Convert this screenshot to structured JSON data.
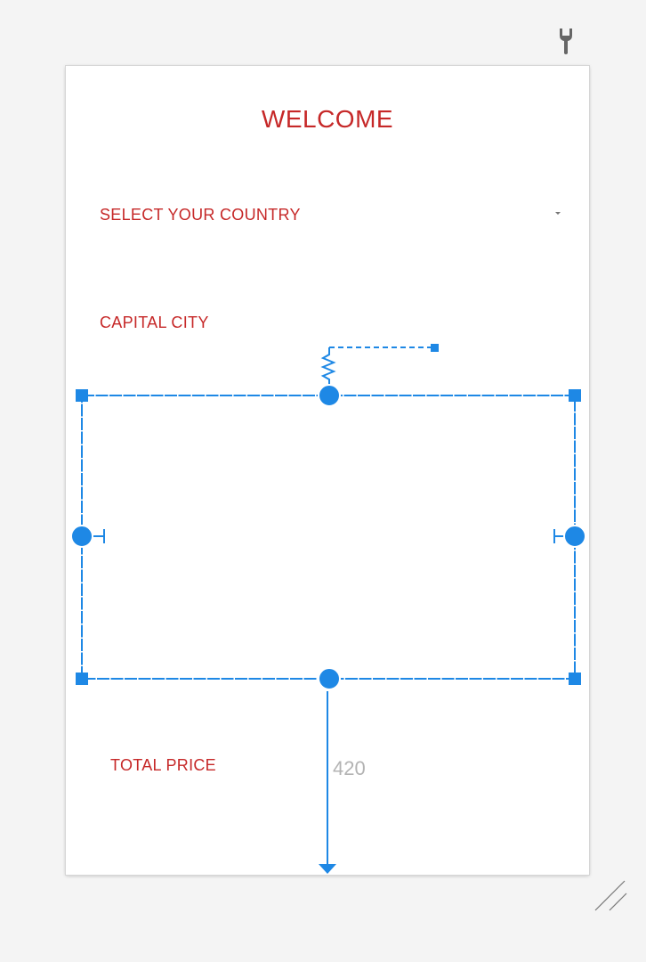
{
  "toolbar": {
    "settings_icon": "wrench-icon"
  },
  "screen": {
    "title": "WELCOME",
    "country_spinner": {
      "selected": "SELECT YOUR COUNTRY",
      "arrow_icon": "dropdown-arrow-icon"
    },
    "capital_label": "CAPITAL CITY",
    "total_price_label": "TOTAL PRICE"
  },
  "selection": {
    "bottom_margin_value": "420"
  },
  "colors": {
    "accent_text": "#c62828",
    "selection_blue": "#1e88e5",
    "canvas_bg": "#f4f4f4",
    "dimension_text": "#b3b3b3"
  }
}
